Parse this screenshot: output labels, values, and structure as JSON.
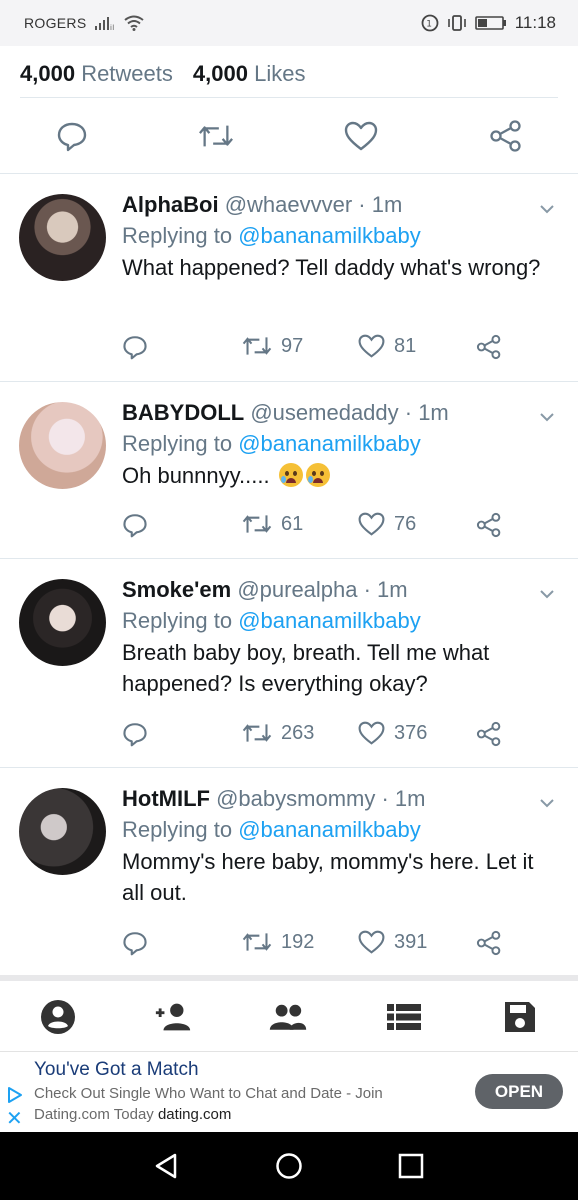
{
  "status_bar": {
    "carrier": "ROGERS",
    "time": "11:18"
  },
  "tweet_stats": {
    "retweets_count": "4,000",
    "retweets_label": "Retweets",
    "likes_count": "4,000",
    "likes_label": "Likes"
  },
  "replies": [
    {
      "name": "AlphaBoi",
      "meta": "@whaevvver · 1m",
      "replying_prefix": "Replying to",
      "replying_handle": "@bananamilkbaby",
      "text": "What happened? Tell daddy what's wrong?",
      "retweets": "97",
      "likes": "81"
    },
    {
      "name": "BABYDOLL",
      "meta": "@usemedaddy · 1m",
      "replying_prefix": "Replying to",
      "replying_handle": "@bananamilkbaby",
      "text": "Oh bunnnyy.....",
      "retweets": "61",
      "likes": "76"
    },
    {
      "name": "Smoke'em",
      "meta": "@purealpha · 1m",
      "replying_prefix": "Replying to",
      "replying_handle": "@bananamilkbaby",
      "text": "Breath baby boy, breath. Tell me what happened? Is everything okay?",
      "retweets": "263",
      "likes": "376"
    },
    {
      "name": "HotMILF",
      "meta": "@babysmommy · 1m",
      "replying_prefix": "Replying to",
      "replying_handle": "@bananamilkbaby",
      "text": "Mommy's here baby, mommy's here. Let it all out.",
      "retweets": "192",
      "likes": "391"
    }
  ],
  "ad": {
    "title": "You've Got a Match",
    "description": "Check Out Single Who Want to Chat and Date - Join Dating.com Today",
    "domain": "dating.com",
    "button": "OPEN"
  },
  "colors": {
    "link": "#1da1f2",
    "muted": "#657786",
    "icon": "#657786",
    "nav_icon": "#333333"
  }
}
